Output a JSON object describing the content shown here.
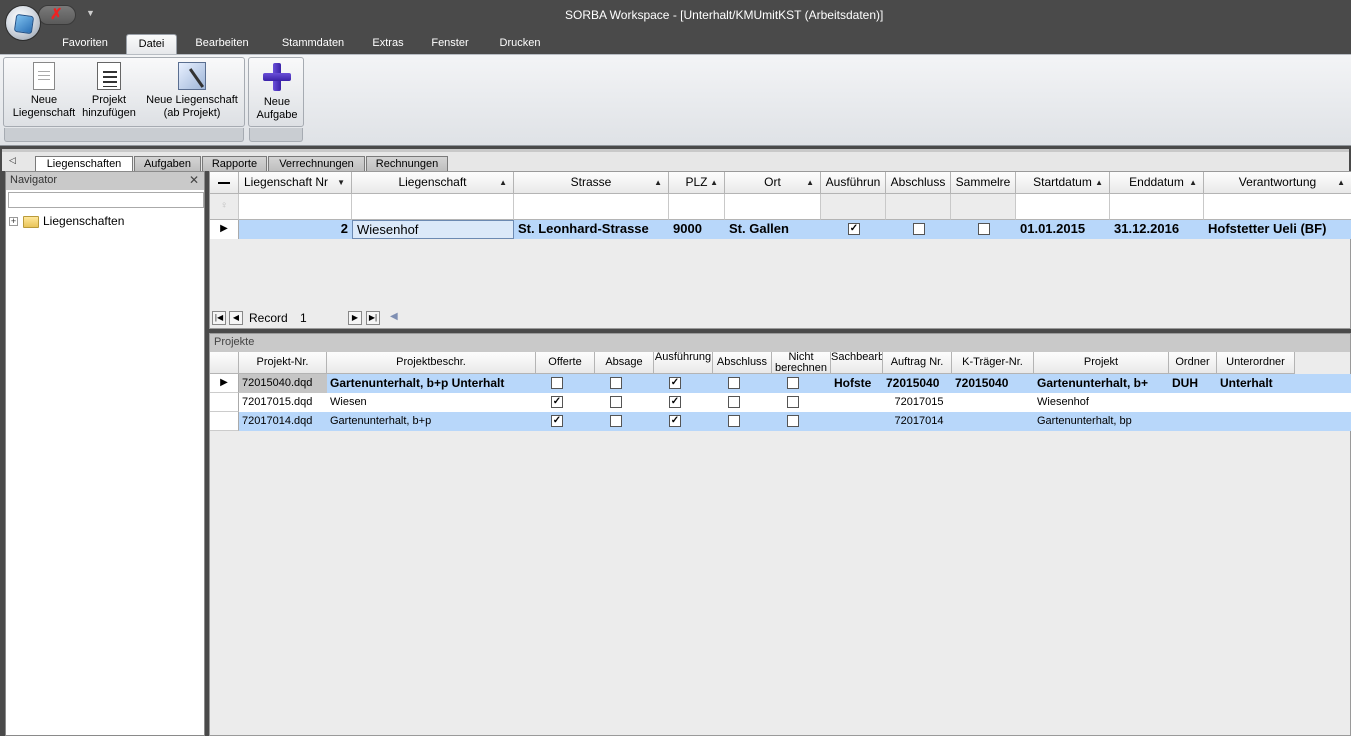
{
  "window": {
    "title": "SORBA Workspace - [Unterhalt/KMUmitKST (Arbeitsdaten)]"
  },
  "ribbon_tabs": [
    "Favoriten",
    "Datei",
    "Bearbeiten",
    "Stammdaten",
    "Extras",
    "Fenster",
    "Drucken"
  ],
  "ribbon": {
    "new_property": [
      "Neue",
      "Liegenschaft"
    ],
    "add_project": [
      "Projekt",
      "hinzufügen"
    ],
    "new_property_from_project": [
      "Neue Liegenschaft",
      "(ab Projekt)"
    ],
    "new_task": [
      "Neue",
      "Aufgabe"
    ]
  },
  "doc_tabs": [
    "Liegenschaften",
    "Aufgaben",
    "Rapporte",
    "Verrechnungen",
    "Rechnungen"
  ],
  "navigator": {
    "title": "Navigator",
    "close": "✕",
    "tree_root": "Liegenschaften",
    "expander": "+"
  },
  "grid1": {
    "headers": [
      "Liegenschaft Nr",
      "Liegenschaft",
      "Strasse",
      "PLZ",
      "Ort",
      "Ausführun",
      "Abschluss",
      "Sammelre",
      "Startdatum",
      "Enddatum",
      "Verantwortung"
    ],
    "row": {
      "nr": "2",
      "liegenschaft": "Wiesenhof",
      "strasse": "St. Leonhard-Strasse",
      "plz": "9000",
      "ort": "St. Gallen",
      "ausfuehrung": true,
      "abschluss": false,
      "sammelre": false,
      "startdatum": "01.01.2015",
      "enddatum": "31.12.2016",
      "verantwortung": "Hofstetter Ueli (BF)"
    },
    "record_label": "Record",
    "record_value": "1"
  },
  "grid2": {
    "caption": "Projekte",
    "headers": [
      "Projekt-Nr.",
      "Projektbeschr.",
      "Offerte",
      "Absage",
      "Ausführung",
      "Abschluss",
      "Nicht berechnen",
      "Sachbearbeiter",
      "Auftrag Nr.",
      "K-Träger-Nr.",
      "Projekt",
      "Ordner",
      "Unterordner"
    ],
    "rows": [
      {
        "nr": "72015040.dqd",
        "beschr": "Gartenunterhalt, b+p Unterhalt",
        "offerte": false,
        "absage": false,
        "ausfuehrung": true,
        "abschluss": false,
        "nicht": false,
        "sachb": "Hofste",
        "auftrag": "72015040",
        "ktraeger": "72015040",
        "projekt": "Gartenunterhalt, b+",
        "ordner": "DUH",
        "unterordner": "Unterhalt"
      },
      {
        "nr": "72017015.dqd",
        "beschr": "Wiesen",
        "offerte": true,
        "absage": false,
        "ausfuehrung": true,
        "abschluss": false,
        "nicht": false,
        "sachb": "",
        "auftrag": "72017015",
        "ktraeger": "",
        "projekt": "Wiesenhof",
        "ordner": "",
        "unterordner": ""
      },
      {
        "nr": "72017014.dqd",
        "beschr": "Gartenunterhalt, b+p",
        "offerte": true,
        "absage": false,
        "ausfuehrung": true,
        "abschluss": false,
        "nicht": false,
        "sachb": "",
        "auftrag": "72017014",
        "ktraeger": "",
        "projekt": "Gartenunterhalt, bp",
        "ordner": "",
        "unterordner": ""
      }
    ]
  },
  "colors": {
    "selection": "#b8d7fa",
    "chrome": "#4a4a4a"
  }
}
